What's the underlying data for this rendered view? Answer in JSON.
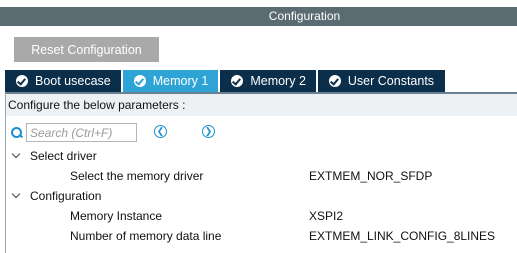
{
  "window": {
    "title": "Configuration"
  },
  "toolbar": {
    "reset_label": "Reset Configuration"
  },
  "tabs": [
    {
      "label": "Boot usecase",
      "active": false
    },
    {
      "label": "Memory 1",
      "active": true
    },
    {
      "label": "Memory 2",
      "active": false
    },
    {
      "label": "User Constants",
      "active": false
    }
  ],
  "panel": {
    "header": "Configure the below parameters :"
  },
  "search": {
    "placeholder": "Search (Ctrl+F)"
  },
  "tree": {
    "groups": [
      {
        "label": "Select driver",
        "params": [
          {
            "name": "Select the memory driver",
            "value": "EXTMEM_NOR_SFDP"
          }
        ]
      },
      {
        "label": "Configuration",
        "params": [
          {
            "name": "Memory Instance",
            "value": "XSPI2"
          },
          {
            "name": "Number of memory data line",
            "value": "EXTMEM_LINK_CONFIG_8LINES"
          }
        ]
      }
    ]
  },
  "colors": {
    "title_bar": "#5a6b72",
    "tab_inactive": "#0b2e4a",
    "tab_active": "#2ea4d6",
    "button": "#a9a9a9",
    "search_accent": "#1a8fcc"
  }
}
